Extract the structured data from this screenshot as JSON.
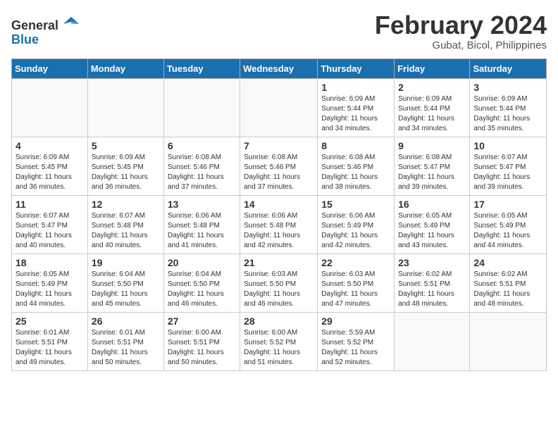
{
  "logo": {
    "general": "General",
    "blue": "Blue"
  },
  "title": {
    "month_year": "February 2024",
    "location": "Gubat, Bicol, Philippines"
  },
  "weekdays": [
    "Sunday",
    "Monday",
    "Tuesday",
    "Wednesday",
    "Thursday",
    "Friday",
    "Saturday"
  ],
  "weeks": [
    [
      {
        "day": "",
        "info": ""
      },
      {
        "day": "",
        "info": ""
      },
      {
        "day": "",
        "info": ""
      },
      {
        "day": "",
        "info": ""
      },
      {
        "day": "1",
        "info": "Sunrise: 6:09 AM\nSunset: 5:44 PM\nDaylight: 11 hours and 34 minutes."
      },
      {
        "day": "2",
        "info": "Sunrise: 6:09 AM\nSunset: 5:44 PM\nDaylight: 11 hours and 34 minutes."
      },
      {
        "day": "3",
        "info": "Sunrise: 6:09 AM\nSunset: 5:44 PM\nDaylight: 11 hours and 35 minutes."
      }
    ],
    [
      {
        "day": "4",
        "info": "Sunrise: 6:09 AM\nSunset: 5:45 PM\nDaylight: 11 hours and 36 minutes."
      },
      {
        "day": "5",
        "info": "Sunrise: 6:09 AM\nSunset: 5:45 PM\nDaylight: 11 hours and 36 minutes."
      },
      {
        "day": "6",
        "info": "Sunrise: 6:08 AM\nSunset: 5:46 PM\nDaylight: 11 hours and 37 minutes."
      },
      {
        "day": "7",
        "info": "Sunrise: 6:08 AM\nSunset: 5:46 PM\nDaylight: 11 hours and 37 minutes."
      },
      {
        "day": "8",
        "info": "Sunrise: 6:08 AM\nSunset: 5:46 PM\nDaylight: 11 hours and 38 minutes."
      },
      {
        "day": "9",
        "info": "Sunrise: 6:08 AM\nSunset: 5:47 PM\nDaylight: 11 hours and 39 minutes."
      },
      {
        "day": "10",
        "info": "Sunrise: 6:07 AM\nSunset: 5:47 PM\nDaylight: 11 hours and 39 minutes."
      }
    ],
    [
      {
        "day": "11",
        "info": "Sunrise: 6:07 AM\nSunset: 5:47 PM\nDaylight: 11 hours and 40 minutes."
      },
      {
        "day": "12",
        "info": "Sunrise: 6:07 AM\nSunset: 5:48 PM\nDaylight: 11 hours and 40 minutes."
      },
      {
        "day": "13",
        "info": "Sunrise: 6:06 AM\nSunset: 5:48 PM\nDaylight: 11 hours and 41 minutes."
      },
      {
        "day": "14",
        "info": "Sunrise: 6:06 AM\nSunset: 5:48 PM\nDaylight: 11 hours and 42 minutes."
      },
      {
        "day": "15",
        "info": "Sunrise: 6:06 AM\nSunset: 5:49 PM\nDaylight: 11 hours and 42 minutes."
      },
      {
        "day": "16",
        "info": "Sunrise: 6:05 AM\nSunset: 5:49 PM\nDaylight: 11 hours and 43 minutes."
      },
      {
        "day": "17",
        "info": "Sunrise: 6:05 AM\nSunset: 5:49 PM\nDaylight: 11 hours and 44 minutes."
      }
    ],
    [
      {
        "day": "18",
        "info": "Sunrise: 6:05 AM\nSunset: 5:49 PM\nDaylight: 11 hours and 44 minutes."
      },
      {
        "day": "19",
        "info": "Sunrise: 6:04 AM\nSunset: 5:50 PM\nDaylight: 11 hours and 45 minutes."
      },
      {
        "day": "20",
        "info": "Sunrise: 6:04 AM\nSunset: 5:50 PM\nDaylight: 11 hours and 46 minutes."
      },
      {
        "day": "21",
        "info": "Sunrise: 6:03 AM\nSunset: 5:50 PM\nDaylight: 11 hours and 46 minutes."
      },
      {
        "day": "22",
        "info": "Sunrise: 6:03 AM\nSunset: 5:50 PM\nDaylight: 11 hours and 47 minutes."
      },
      {
        "day": "23",
        "info": "Sunrise: 6:02 AM\nSunset: 5:51 PM\nDaylight: 11 hours and 48 minutes."
      },
      {
        "day": "24",
        "info": "Sunrise: 6:02 AM\nSunset: 5:51 PM\nDaylight: 11 hours and 48 minutes."
      }
    ],
    [
      {
        "day": "25",
        "info": "Sunrise: 6:01 AM\nSunset: 5:51 PM\nDaylight: 11 hours and 49 minutes."
      },
      {
        "day": "26",
        "info": "Sunrise: 6:01 AM\nSunset: 5:51 PM\nDaylight: 11 hours and 50 minutes."
      },
      {
        "day": "27",
        "info": "Sunrise: 6:00 AM\nSunset: 5:51 PM\nDaylight: 11 hours and 50 minutes."
      },
      {
        "day": "28",
        "info": "Sunrise: 6:00 AM\nSunset: 5:52 PM\nDaylight: 11 hours and 51 minutes."
      },
      {
        "day": "29",
        "info": "Sunrise: 5:59 AM\nSunset: 5:52 PM\nDaylight: 11 hours and 52 minutes."
      },
      {
        "day": "",
        "info": ""
      },
      {
        "day": "",
        "info": ""
      }
    ]
  ]
}
